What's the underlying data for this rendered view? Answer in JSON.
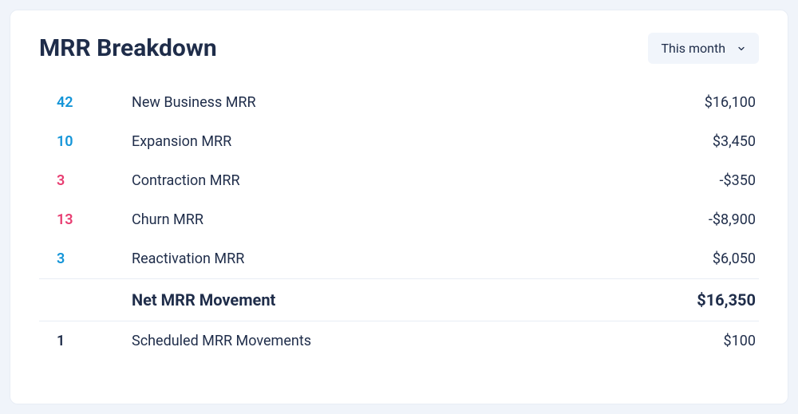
{
  "title": "MRR Breakdown",
  "period": {
    "label": "This month"
  },
  "rows": [
    {
      "count": "42",
      "count_color": "blue",
      "label": "New Business MRR",
      "value": "$16,100"
    },
    {
      "count": "10",
      "count_color": "blue",
      "label": "Expansion MRR",
      "value": "$3,450"
    },
    {
      "count": "3",
      "count_color": "red",
      "label": "Contraction MRR",
      "value": "-$350"
    },
    {
      "count": "13",
      "count_color": "red",
      "label": "Churn MRR",
      "value": "-$8,900"
    },
    {
      "count": "3",
      "count_color": "blue",
      "label": "Reactivation MRR",
      "value": "$6,050"
    }
  ],
  "total": {
    "label": "Net MRR Movement",
    "value": "$16,350"
  },
  "footer_row": {
    "count": "1",
    "label": "Scheduled MRR Movements",
    "value": "$100"
  }
}
